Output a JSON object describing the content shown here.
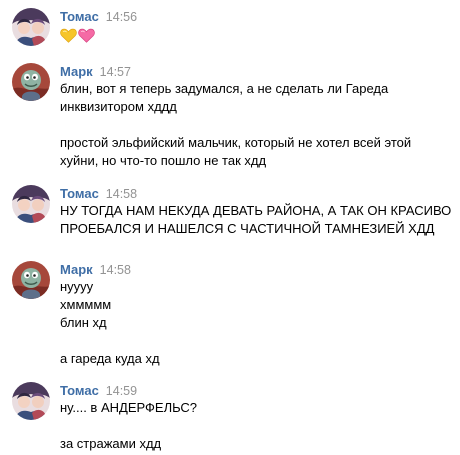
{
  "colors": {
    "author": "#3f6ea6",
    "timestamp": "#939393",
    "text": "#000000",
    "background": "#ffffff"
  },
  "messages": [
    {
      "author": "Томас",
      "time": "14:56",
      "avatar": "anime-avatar",
      "emoji": [
        "yellow-heart-icon",
        "pink-heart-icon"
      ],
      "lines": []
    },
    {
      "author": "Марк",
      "time": "14:57",
      "avatar": "cartoon-avatar",
      "lines": [
        "блин, вот я теперь задумался, а не сделать ли Гареда",
        "инквизитором хддд",
        "",
        "простой эльфийский мальчик, который не хотел всей этой",
        "хуйни, но что-то пошло не так хдд"
      ]
    },
    {
      "author": "Томас",
      "time": "14:58",
      "avatar": "anime-avatar",
      "lines": [
        "НУ ТОГДА НАМ НЕКУДА ДЕВАТЬ РАЙОНА, А ТАК ОН КРАСИВО",
        "ПРОЕБАЛСЯ И НАШЕЛСЯ С ЧАСТИЧНОЙ ТАМНЕЗИЕЙ ХДД"
      ]
    },
    {
      "author": "Марк",
      "time": "14:58",
      "avatar": "cartoon-avatar",
      "lines": [
        "нуууу",
        "хммммм",
        "блин хд",
        "",
        "а гареда куда хд"
      ]
    },
    {
      "author": "Томас",
      "time": "14:59",
      "avatar": "anime-avatar",
      "lines": [
        "ну.... в АНДЕРФЕЛЬС?",
        "",
        "за стражами хдд"
      ]
    }
  ]
}
